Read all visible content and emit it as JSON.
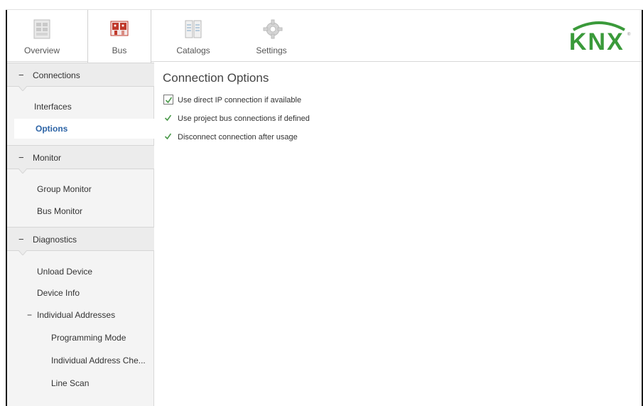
{
  "ribbon": {
    "tabs": [
      {
        "label": "Overview",
        "icon": "overview-icon"
      },
      {
        "label": "Bus",
        "icon": "bus-icon"
      },
      {
        "label": "Catalogs",
        "icon": "catalogs-icon"
      },
      {
        "label": "Settings",
        "icon": "settings-icon"
      }
    ],
    "active_tab": "Bus",
    "logo_text": "KNX",
    "logo_color": "#3a9a3a"
  },
  "sidebar": {
    "connections": {
      "header": "Connections",
      "items": [
        "Interfaces",
        "Options"
      ],
      "selected": "Options"
    },
    "monitor": {
      "header": "Monitor",
      "items": [
        "Group Monitor",
        "Bus Monitor"
      ]
    },
    "diagnostics": {
      "header": "Diagnostics",
      "items": [
        "Unload Device",
        "Device Info"
      ],
      "group": {
        "label": "Individual Addresses",
        "items": [
          "Programming Mode",
          "Individual Address Che...",
          "Line Scan"
        ]
      }
    },
    "collapse_glyph": "−"
  },
  "main": {
    "title": "Connection Options",
    "options": [
      {
        "label": "Use direct IP connection if available",
        "checked": true,
        "focused": true
      },
      {
        "label": "Use project bus connections if defined",
        "checked": true
      },
      {
        "label": "Disconnect connection after usage",
        "checked": true
      }
    ]
  },
  "colors": {
    "accent": "#2d64a6",
    "check": "#4a9a4a",
    "sidebar_bg": "#f4f4f4"
  }
}
